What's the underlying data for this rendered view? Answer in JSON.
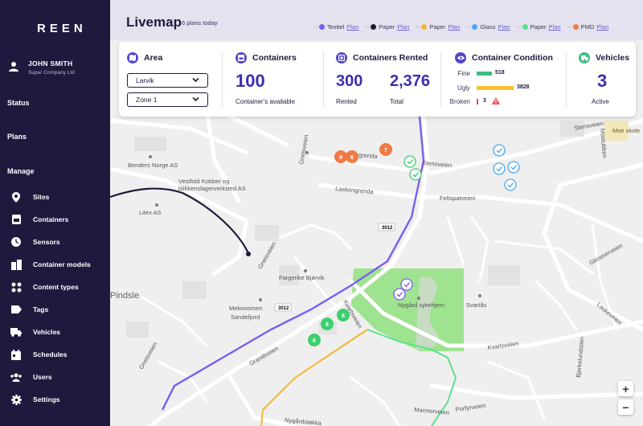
{
  "app": {
    "logo": "REEN"
  },
  "user": {
    "name": "JOHN SMITH",
    "company": "Super Company Ltd"
  },
  "nav": {
    "status": "Status",
    "plans": "Plans",
    "manage": "Manage",
    "items": [
      {
        "label": "Sites",
        "icon": "location-pin-icon"
      },
      {
        "label": "Containers",
        "icon": "container-icon"
      },
      {
        "label": "Sensors",
        "icon": "sensor-icon"
      },
      {
        "label": "Container models",
        "icon": "container-models-icon"
      },
      {
        "label": "Content types",
        "icon": "content-types-icon"
      },
      {
        "label": "Tags",
        "icon": "tag-icon"
      },
      {
        "label": "Vehicles",
        "icon": "truck-icon"
      },
      {
        "label": "Schedules",
        "icon": "calendar-icon"
      },
      {
        "label": "Users",
        "icon": "users-icon"
      },
      {
        "label": "Settings",
        "icon": "gear-icon"
      }
    ]
  },
  "header": {
    "title": "Livemap",
    "plans_today": "6 plans today",
    "legend": [
      {
        "label": "Textiel",
        "link": "Plan",
        "color": "#7b5cf0"
      },
      {
        "label": "Paper",
        "link": "Plan",
        "color": "#1f1a3d"
      },
      {
        "label": "Paper",
        "link": "Plan",
        "color": "#f5b731"
      },
      {
        "label": "Glass",
        "link": "Plan",
        "color": "#4aa8f0"
      },
      {
        "label": "Paper",
        "link": "Plan",
        "color": "#5ee08a"
      },
      {
        "label": "PMD",
        "link": "Plan",
        "color": "#f07a45"
      }
    ]
  },
  "stats": {
    "area": {
      "title": "Area",
      "select1": "Larvik",
      "select2": "Zone 1"
    },
    "containers": {
      "title": "Containers",
      "value": "100",
      "caption": "Container's available"
    },
    "rented": {
      "title": "Containers Rented",
      "rented_value": "300",
      "rented_label": "Rented",
      "total_value": "2,376",
      "total_label": "Total"
    },
    "condition": {
      "title": "Container Condition",
      "rows": [
        {
          "label": "Fine",
          "value": "518",
          "color": "#3dbf82"
        },
        {
          "label": "Ugly",
          "value": "3828",
          "color": "#f5c531"
        },
        {
          "label": "Broken",
          "value": "3",
          "color": "#ef4d4d"
        }
      ]
    },
    "vehicles": {
      "title": "Vehicles",
      "value": "3",
      "caption": "Active"
    }
  },
  "map": {
    "labels": {
      "stensveien": "Stensveien",
      "stensveien2": "Stensveien",
      "laskengrenda": "Laskengrenda",
      "laskengrenda2": "Laskengrenda",
      "feltspatveien": "Feltspatveien",
      "gneisveien": "Gneisveien",
      "gneisveien2": "Gneisveien",
      "granittveien": "Granittveien",
      "kvartsveien": "Kvartsveien",
      "kvartsveien2": "Kvartsveien",
      "laskeveien": "Laskeveien",
      "glimmerveien": "Glimmerveien",
      "bjerkelundstien": "Bjerkelundstien",
      "mostubben": "Mostubben",
      "marmorveien": "Marmorveien",
      "porfyrveien": "Porfyrveien",
      "nygardslokka": "Nygårdsløkka",
      "pindsle": "Pindsle",
      "benders": "Benders Norge AS",
      "vestfold": "Vestfold Kobber og",
      "vestfold2": "blikkenslagerverksted AS",
      "litex": "Litex AS",
      "fargerike": "Fargerike Bjørvik",
      "mekonomen": "Mekonomen",
      "mekonomen2": "Sandefjord",
      "nygard": "Nygård sykehjem",
      "svartas": "Svartås",
      "moe": "Moe skole",
      "road3012": "3012",
      "road3012b": "3012"
    },
    "zoom_in": "+",
    "zoom_out": "−",
    "clusters": [
      {
        "value": "7",
        "color": "#f07a45"
      },
      {
        "value": "9",
        "color": "#f07a45"
      },
      {
        "value": "6",
        "color": "#f07a45"
      },
      {
        "value": "8",
        "color": "#3dcf6f"
      },
      {
        "value": "8",
        "color": "#3dcf6f"
      },
      {
        "value": "6",
        "color": "#3dcf6f"
      }
    ]
  }
}
